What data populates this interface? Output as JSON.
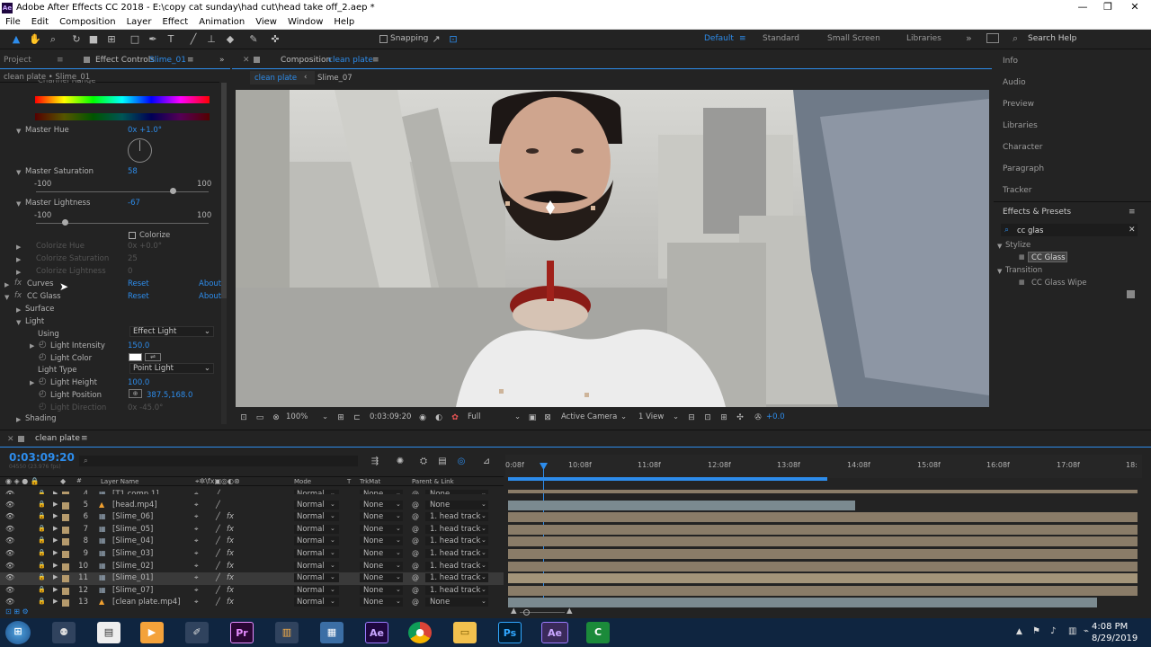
{
  "window": {
    "title": "Adobe After Effects CC 2018 - E:\\copy cat sunday\\had cut\\head take off_2.aep *",
    "app_badge": "Ae",
    "minimize": "—",
    "maximize": "❐",
    "close": "✕"
  },
  "menu": [
    "File",
    "Edit",
    "Composition",
    "Layer",
    "Effect",
    "Animation",
    "View",
    "Window",
    "Help"
  ],
  "toolbar": {
    "snapping_label": "Snapping",
    "workspaces": [
      "Default",
      "Standard",
      "Small Screen",
      "Libraries"
    ],
    "active_workspace": "Default",
    "search_placeholder": "Search Help"
  },
  "effect_controls": {
    "tab_project": "Project",
    "tab_effect_prefix": "Effect Controls",
    "tab_effect_layer": "Slime_01",
    "breadcrumb": "clean plate • Slime_01",
    "partial_top": "Channel Range",
    "master_hue": {
      "label": "Master Hue",
      "value": "0x +1.0°"
    },
    "master_saturation": {
      "label": "Master Saturation",
      "value": "58",
      "min": "-100",
      "max": "100",
      "level": 58
    },
    "master_lightness": {
      "label": "Master Lightness",
      "value": "-67",
      "min": "-100",
      "max": "100",
      "level": -67
    },
    "colorize": {
      "label": "Colorize",
      "checked": false
    },
    "colorize_hue": {
      "label": "Colorize Hue",
      "value": "0x +0.0°"
    },
    "colorize_saturation": {
      "label": "Colorize Saturation",
      "value": "25"
    },
    "colorize_lightness": {
      "label": "Colorize Lightness",
      "value": "0"
    },
    "curves": {
      "label": "Curves",
      "reset": "Reset",
      "about": "About"
    },
    "cc_glass": {
      "label": "CC Glass",
      "reset": "Reset",
      "about": "About"
    },
    "surface": "Surface",
    "light": "Light",
    "using": {
      "label": "Using",
      "value": "Effect Light"
    },
    "light_intensity": {
      "label": "Light Intensity",
      "value": "150.0"
    },
    "light_color": {
      "label": "Light Color",
      "swatch": "#ffffff"
    },
    "light_type": {
      "label": "Light Type",
      "value": "Point Light"
    },
    "light_height": {
      "label": "Light Height",
      "value": "100.0"
    },
    "light_position": {
      "label": "Light Position",
      "value": "387.5,168.0"
    },
    "light_direction": {
      "label": "Light Direction",
      "value": "0x -45.0°"
    },
    "shading": "Shading"
  },
  "composition": {
    "tab_prefix": "Composition",
    "tab_name": "clean plate",
    "breadcrumb_active": "clean plate",
    "breadcrumb_next": "Slime_07",
    "zoom": "100%",
    "timecode": "0:03:09:20",
    "resolution": "Full",
    "camera": "Active Camera",
    "views": "1 View",
    "exposure": "+0.0"
  },
  "right_panels": {
    "items": [
      "Info",
      "Audio",
      "Preview",
      "Libraries",
      "Character",
      "Paragraph",
      "Tracker"
    ],
    "effects_presets": "Effects & Presets",
    "search_value": "cc glas",
    "groups": [
      {
        "name": "Stylize",
        "items": [
          "CC Glass"
        ]
      },
      {
        "name": "Transition",
        "items": [
          "CC Glass Wipe"
        ]
      }
    ]
  },
  "timeline": {
    "tab": "clean plate",
    "timecode": "0:03:09:20",
    "sub_timecode": "04550 (23.976 fps)",
    "headers": {
      "layer_name": "Layer Name",
      "mode": "Mode",
      "t": "T",
      "trkmat": "TrkMat",
      "parent": "Parent & Link"
    },
    "ruler": [
      "0:08f",
      "10:08f",
      "11:08f",
      "12:08f",
      "13:08f",
      "14:08f",
      "15:08f",
      "16:08f",
      "17:08f",
      "18:"
    ],
    "layers": [
      {
        "num": "4",
        "name": "[T1 comp 1]",
        "mode": "Normal",
        "trkmat": "None",
        "parent": "None",
        "fx": false
      },
      {
        "num": "5",
        "name": "[head.mp4]",
        "mode": "Normal",
        "trkmat": "None",
        "parent": "None",
        "fx": false
      },
      {
        "num": "6",
        "name": "[Slime_06]",
        "mode": "Normal",
        "trkmat": "None",
        "parent": "1. head track",
        "fx": true
      },
      {
        "num": "7",
        "name": "[Slime_05]",
        "mode": "Normal",
        "trkmat": "None",
        "parent": "1. head track",
        "fx": true
      },
      {
        "num": "8",
        "name": "[Slime_04]",
        "mode": "Normal",
        "trkmat": "None",
        "parent": "1. head track",
        "fx": true
      },
      {
        "num": "9",
        "name": "[Slime_03]",
        "mode": "Normal",
        "trkmat": "None",
        "parent": "1. head track",
        "fx": true
      },
      {
        "num": "10",
        "name": "[Slime_02]",
        "mode": "Normal",
        "trkmat": "None",
        "parent": "1. head track",
        "fx": true
      },
      {
        "num": "11",
        "name": "[Slime_01]",
        "mode": "Normal",
        "trkmat": "None",
        "parent": "1. head track",
        "fx": true
      },
      {
        "num": "12",
        "name": "[Slime_07]",
        "mode": "Normal",
        "trkmat": "None",
        "parent": "1. head track",
        "fx": true
      },
      {
        "num": "13",
        "name": "[clean plate.mp4]",
        "mode": "Normal",
        "trkmat": "None",
        "parent": "None",
        "fx": true
      }
    ]
  },
  "taskbar": {
    "time": "4:08 PM",
    "date": "8/29/2019",
    "apps": [
      "Pr",
      "Ae",
      "Ps",
      "Ae"
    ]
  }
}
